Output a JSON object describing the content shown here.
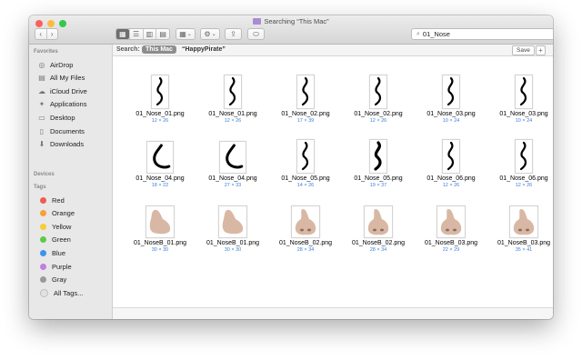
{
  "window": {
    "title": "Searching “This Mac”",
    "traffic_lights": {
      "close": "#fc605c",
      "minimize": "#fdbc40",
      "zoom": "#34c84a"
    }
  },
  "toolbar": {
    "back_icon": "‹",
    "forward_icon": "›",
    "view_icons": [
      "▦",
      "☰",
      "▥",
      "▤"
    ],
    "group_icon": "▦",
    "action_icon": "⚙",
    "share_icon": "⇪",
    "tag_icon": "⬭",
    "chevron": "⌄"
  },
  "search": {
    "value": "01_Nose",
    "icon": "🔍",
    "clear_icon": "✕"
  },
  "sidebar": {
    "favorites_header": "Favorites",
    "favorites": [
      {
        "label": "AirDrop",
        "icon": "◎"
      },
      {
        "label": "All My Files",
        "icon": "▤"
      },
      {
        "label": "iCloud Drive",
        "icon": "☁"
      },
      {
        "label": "Applications",
        "icon": "✦"
      },
      {
        "label": "Desktop",
        "icon": "▭"
      },
      {
        "label": "Documents",
        "icon": "▯"
      },
      {
        "label": "Downloads",
        "icon": "⬇"
      }
    ],
    "devices_header": "Devices",
    "tags_header": "Tags",
    "tags": [
      {
        "label": "Red",
        "color": "#f25a55"
      },
      {
        "label": "Orange",
        "color": "#f7a03a"
      },
      {
        "label": "Yellow",
        "color": "#f5cf33"
      },
      {
        "label": "Green",
        "color": "#5dcb49"
      },
      {
        "label": "Blue",
        "color": "#3b95ee"
      },
      {
        "label": "Purple",
        "color": "#c47ee0"
      },
      {
        "label": "Gray",
        "color": "#9a9a9a"
      },
      {
        "label": "All Tags...",
        "color": "#e2e2e2"
      }
    ]
  },
  "scopebar": {
    "label": "Search:",
    "scope_active": "This Mac",
    "scope_other": "“HappyPirate”",
    "save_label": "Save",
    "add_label": "+"
  },
  "files": [
    {
      "name": "01_Nose_01.png",
      "dims": "12 × 26",
      "kind": "line"
    },
    {
      "name": "01_Nose_01.png",
      "dims": "12 × 26",
      "kind": "line"
    },
    {
      "name": "01_Nose_02.png",
      "dims": "17 × 39",
      "kind": "line"
    },
    {
      "name": "01_Nose_02.png",
      "dims": "12 × 26",
      "kind": "line"
    },
    {
      "name": "01_Nose_03.png",
      "dims": "10 × 24",
      "kind": "line"
    },
    {
      "name": "01_Nose_03.png",
      "dims": "10 × 24",
      "kind": "line"
    },
    {
      "name": "01_Nose_04.png",
      "dims": "18 × 22",
      "kind": "line-wide"
    },
    {
      "name": "01_Nose_04.png",
      "dims": "27 × 33",
      "kind": "line-wide"
    },
    {
      "name": "01_Nose_05.png",
      "dims": "14 × 26",
      "kind": "line"
    },
    {
      "name": "01_Nose_05.png",
      "dims": "19 × 37",
      "kind": "line"
    },
    {
      "name": "01_Nose_06.png",
      "dims": "12 × 26",
      "kind": "line"
    },
    {
      "name": "01_Nose_06.png",
      "dims": "12 × 26",
      "kind": "line"
    },
    {
      "name": "01_NoseB_01.png",
      "dims": "30 × 30",
      "kind": "blob"
    },
    {
      "name": "01_NoseB_01.png",
      "dims": "30 × 30",
      "kind": "blob"
    },
    {
      "name": "01_NoseB_02.png",
      "dims": "28 × 34",
      "kind": "nose"
    },
    {
      "name": "01_NoseB_02.png",
      "dims": "28 × 34",
      "kind": "nose"
    },
    {
      "name": "01_NoseB_03.png",
      "dims": "22 × 29",
      "kind": "nose"
    },
    {
      "name": "01_NoseB_03.png",
      "dims": "35 × 41",
      "kind": "nose"
    }
  ]
}
